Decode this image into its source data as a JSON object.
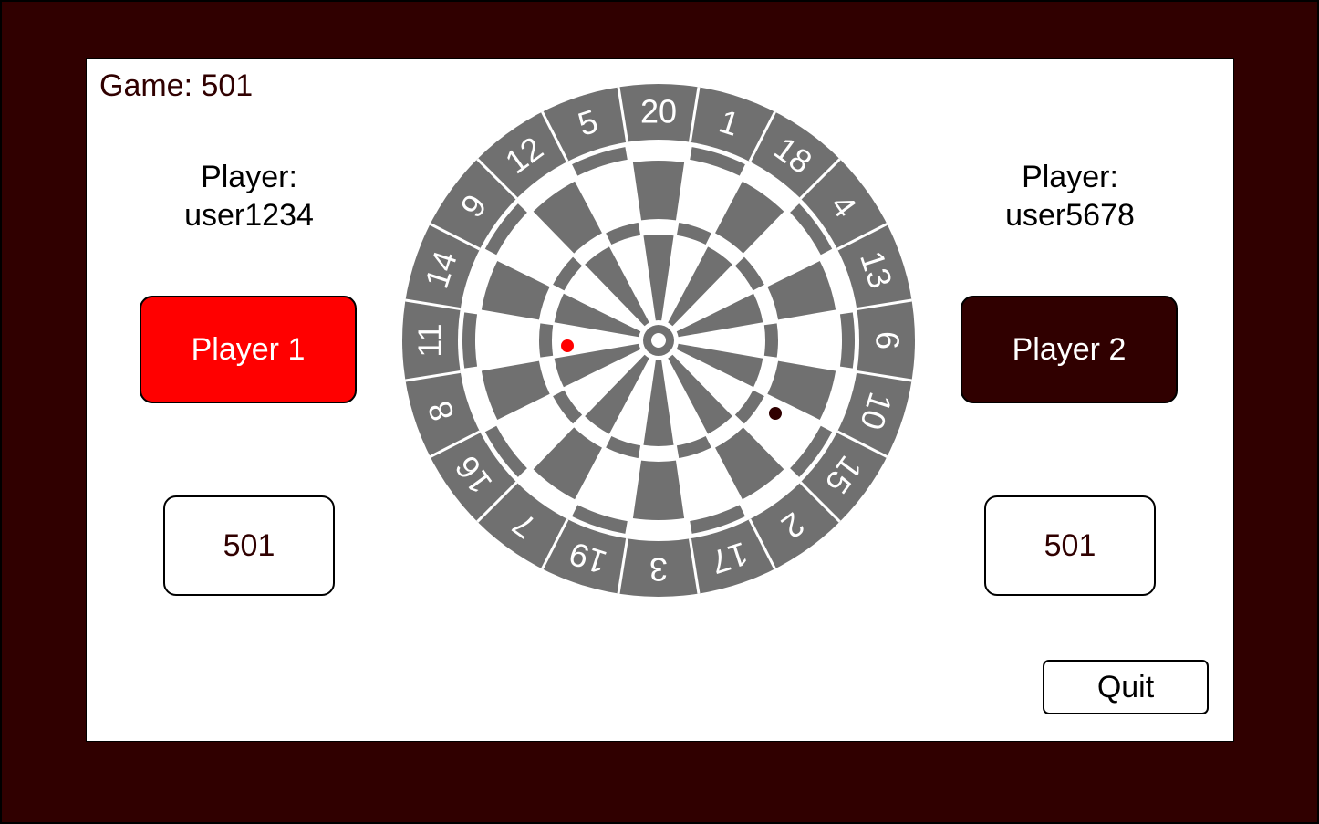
{
  "game": {
    "title": "Game: 501"
  },
  "players": [
    {
      "label_line1": "Player:",
      "label_line2": "user1234",
      "button_label": "Player 1",
      "button_color": "#ff0000",
      "score": "501"
    },
    {
      "label_line1": "Player:",
      "label_line2": "user5678",
      "button_label": "Player 2",
      "button_color": "#300000",
      "score": "501"
    }
  ],
  "dartboard": {
    "sector_numbers": [
      "20",
      "1",
      "18",
      "4",
      "13",
      "6",
      "10",
      "15",
      "2",
      "17",
      "3",
      "19",
      "7",
      "16",
      "8",
      "11",
      "14",
      "9",
      "12",
      "5"
    ],
    "segment_color": "#707070",
    "darts": [
      {
        "player": "Player 1",
        "color": "#ff0000"
      },
      {
        "player": "Player 2",
        "color": "#300000"
      }
    ]
  },
  "actions": {
    "quit_label": "Quit"
  }
}
